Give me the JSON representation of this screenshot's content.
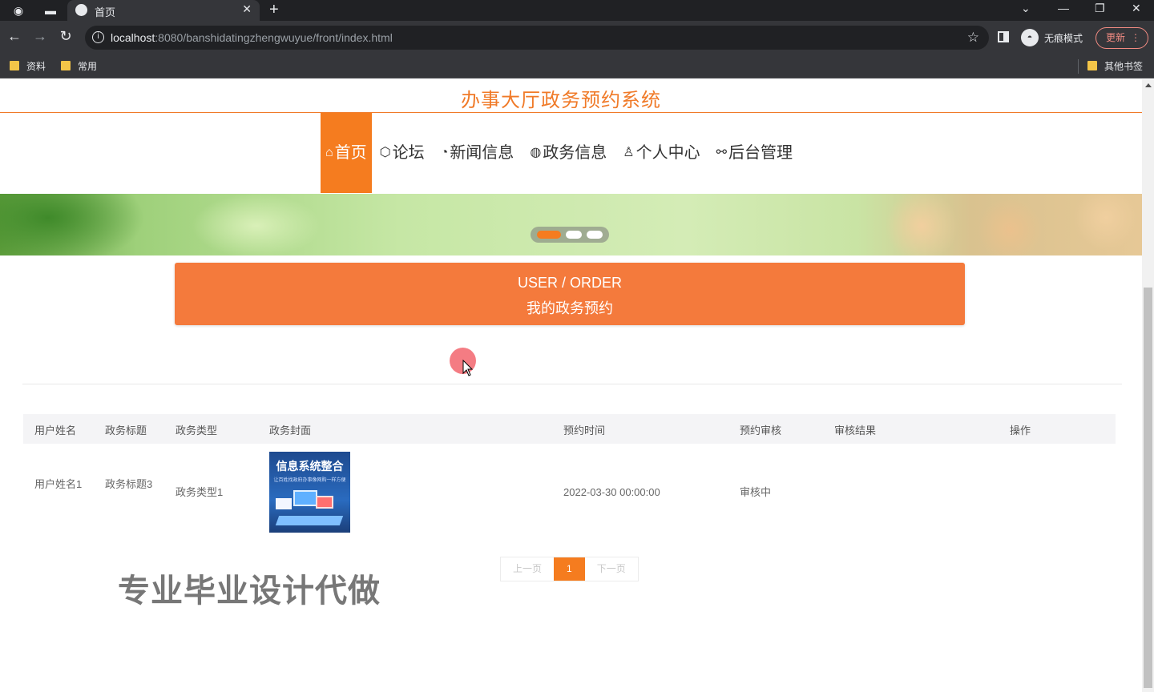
{
  "browser": {
    "tab_title": "首页",
    "url_host": "localhost",
    "url_path": ":8080/banshidatingzhengwuyue/front/index.html",
    "incognito_label": "无痕模式",
    "update_label": "更新",
    "bookmarks": [
      {
        "label": "资料"
      },
      {
        "label": "常用"
      }
    ],
    "other_bookmarks": "其他书签"
  },
  "site": {
    "title": "办事大厅政务预约系统",
    "accent_color": "#f57c1f"
  },
  "nav": [
    {
      "icon": "home-icon",
      "glyph": "⌂",
      "label": "首页",
      "active": true
    },
    {
      "icon": "cube-icon",
      "glyph": "⬡",
      "label": "论坛",
      "active": false
    },
    {
      "icon": "palette-icon",
      "glyph": "◔",
      "label": "新闻信息",
      "active": false
    },
    {
      "icon": "globe-icon",
      "glyph": "◍",
      "label": "政务信息",
      "active": false
    },
    {
      "icon": "user-icon",
      "glyph": "♙",
      "label": "个人中心",
      "active": false
    },
    {
      "icon": "link-icon",
      "glyph": "⚯",
      "label": "后台管理",
      "active": false
    }
  ],
  "order_banner": {
    "en": "USER / ORDER",
    "cn": "我的政务预约"
  },
  "table": {
    "headers": [
      "用户姓名",
      "政务标题",
      "政务类型",
      "政务封面",
      "预约时间",
      "预约审核",
      "审核结果",
      "操作"
    ],
    "rows": [
      {
        "user_name": "用户姓名1",
        "title": "政务标题3",
        "type": "政务类型1",
        "cover_title": "信息系统整合",
        "cover_subtitle": "让百姓找政府办事像网购一样方便",
        "time": "2022-03-30 00:00:00",
        "review": "审核中",
        "result": "",
        "action": ""
      }
    ]
  },
  "pager": {
    "prev": "上一页",
    "current": "1",
    "next": "下一页"
  },
  "watermark": "专业毕业设计代做"
}
